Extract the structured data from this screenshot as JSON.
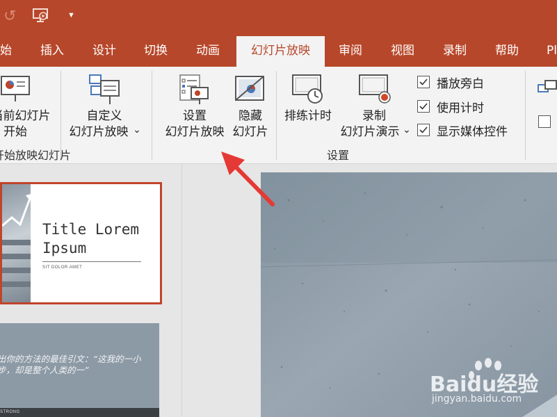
{
  "colors": {
    "accent": "#b7472a",
    "ribbon_bg": "#f3f3f3",
    "selection_border": "#c0442a",
    "annotation_arrow": "#e53935"
  },
  "quick_access": {
    "undo_icon": "redo-icon",
    "slideshow_icon": "from-beginning-icon",
    "dropdown_icon": "customize-dropdown-icon"
  },
  "tabs": [
    {
      "label": "始",
      "active": false
    },
    {
      "label": "插入",
      "active": false
    },
    {
      "label": "设计",
      "active": false
    },
    {
      "label": "切换",
      "active": false
    },
    {
      "label": "动画",
      "active": false
    },
    {
      "label": "幻灯片放映",
      "active": true
    },
    {
      "label": "审阅",
      "active": false
    },
    {
      "label": "视图",
      "active": false
    },
    {
      "label": "录制",
      "active": false
    },
    {
      "label": "帮助",
      "active": false
    },
    {
      "label": "Pl",
      "active": false
    }
  ],
  "ribbon": {
    "start_group": {
      "from_current_line1": "当前幻灯片",
      "from_current_line2": "开始",
      "custom_line1": "自定义",
      "custom_line2": "幻灯片放映",
      "custom_dropdown": "⌄",
      "group_label": "开始放映幻灯片"
    },
    "setup_group": {
      "setup_line1": "设置",
      "setup_line2": "幻灯片放映",
      "hide_line1": "隐藏",
      "hide_line2": "幻灯片",
      "rehearse": "排练计时",
      "record_line1": "录制",
      "record_line2": "幻灯片演示",
      "record_dropdown": "⌄",
      "checkboxes": [
        {
          "label": "播放旁白",
          "checked": true
        },
        {
          "label": "使用计时",
          "checked": true
        },
        {
          "label": "显示媒体控件",
          "checked": true
        }
      ],
      "group_label": "设置"
    },
    "monitor_group": {
      "checkbox_checked": false
    }
  },
  "slides": {
    "thumb1": {
      "title": "Title Lorem Ipsum",
      "subtitle": "SIT DOLOR AMET"
    },
    "thumb2": {
      "quote": "出你的方法的最佳引文：“这我的一小步，却是整个人类的一”",
      "footer": "STRONG"
    }
  },
  "watermark": {
    "brand": "Baidu经验",
    "url": "jingyan.baidu.com"
  }
}
